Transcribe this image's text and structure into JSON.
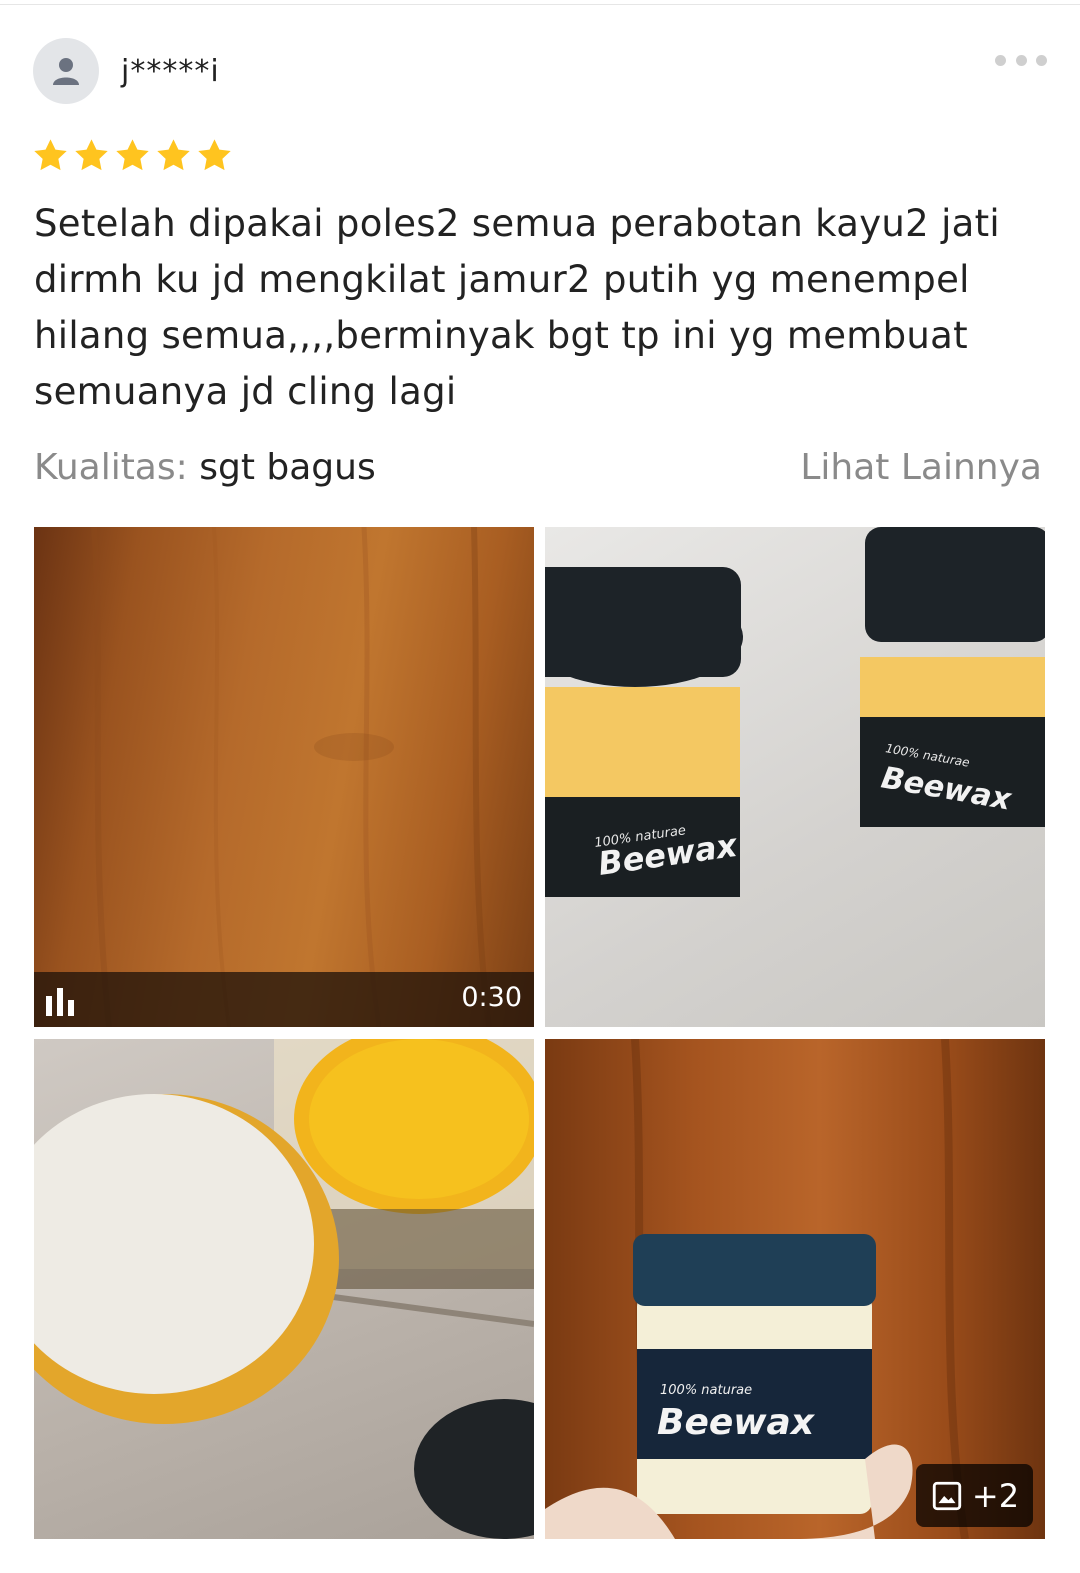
{
  "review": {
    "username": "j*****i",
    "rating": 5,
    "text": "Setelah dipakai poles2 semua perabotan kayu2 jati dirmh ku jd mengkilat jamur2 putih yg menempel hilang semua,,,,berminyak bgt tp ini yg membuat semuanya jd cling lagi",
    "quality_label": "Kualitas:",
    "quality_value": "sgt bagus",
    "see_more": "Lihat Lainnya"
  },
  "media": {
    "video_duration": "0:30",
    "extra_count": "+2",
    "product_label_small": "100% naturae",
    "product_label_big": "Beewax"
  },
  "icons": {
    "avatar": "user-icon",
    "more": "more-dots-icon",
    "star": "star-icon",
    "video": "audio-bars-icon",
    "gallery": "image-icon"
  },
  "colors": {
    "star": "#FFC41F",
    "text_secondary": "#8A8A8A"
  }
}
